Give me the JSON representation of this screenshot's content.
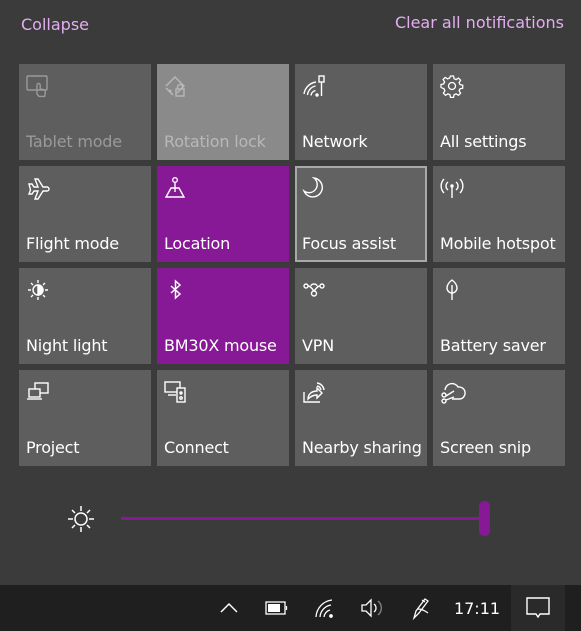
{
  "header": {
    "collapse_label": "Collapse",
    "clear_label": "Clear all notifications"
  },
  "tiles": [
    {
      "label": "Tablet mode",
      "icon": "tablet-mode-icon",
      "state": "disabled"
    },
    {
      "label": "Rotation lock",
      "icon": "rotation-lock-icon",
      "state": "disabled"
    },
    {
      "label": "Network",
      "icon": "network-icon",
      "state": "off"
    },
    {
      "label": "All settings",
      "icon": "gear-icon",
      "state": "off"
    },
    {
      "label": "Flight mode",
      "icon": "airplane-icon",
      "state": "off"
    },
    {
      "label": "Location",
      "icon": "location-icon",
      "state": "on"
    },
    {
      "label": "Focus assist",
      "icon": "moon-icon",
      "state": "focused"
    },
    {
      "label": "Mobile hotspot",
      "icon": "hotspot-icon",
      "state": "off"
    },
    {
      "label": "Night light",
      "icon": "night-light-icon",
      "state": "off"
    },
    {
      "label": "BM30X mouse",
      "icon": "bluetooth-icon",
      "state": "on"
    },
    {
      "label": "VPN",
      "icon": "vpn-icon",
      "state": "off"
    },
    {
      "label": "Battery saver",
      "icon": "leaf-icon",
      "state": "off"
    },
    {
      "label": "Project",
      "icon": "project-icon",
      "state": "off"
    },
    {
      "label": "Connect",
      "icon": "connect-icon",
      "state": "off"
    },
    {
      "label": "Nearby sharing",
      "icon": "nearby-sharing-icon",
      "state": "off"
    },
    {
      "label": "Screen snip",
      "icon": "screen-snip-icon",
      "state": "off"
    }
  ],
  "brightness": {
    "value_percent": 100
  },
  "taskbar": {
    "time": "17:11",
    "icons": [
      "chevron-up-icon",
      "battery-icon",
      "wifi-icon",
      "volume-icon",
      "pen-icon",
      "action-center-icon"
    ]
  },
  "colors": {
    "accent": "#871896",
    "link": "#e3aef0",
    "tile": "#5e5e5e",
    "background": "#3b3b3b",
    "taskbar": "#1f1f1f"
  }
}
